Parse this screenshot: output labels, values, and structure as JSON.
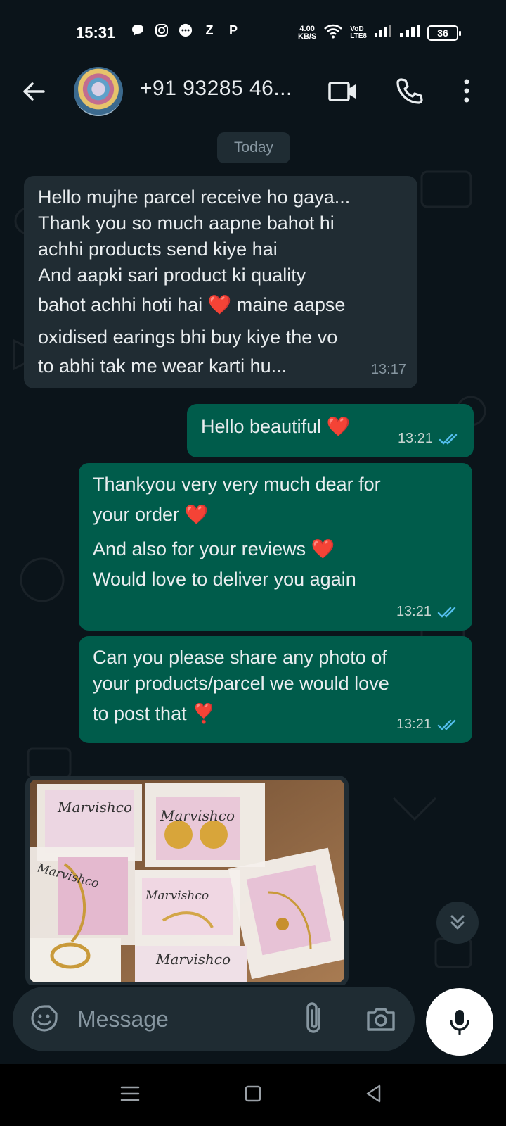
{
  "status_bar": {
    "time": "15:31",
    "left_icons": [
      "chat-bubble-icon",
      "instagram-icon",
      "message-dots-icon",
      "z-icon",
      "p-icon"
    ],
    "z_label": "Z",
    "p_label": "P",
    "speed_value": "4.00",
    "speed_unit": "KB/S",
    "volte_top": "VoD",
    "volte_bottom": "LTE8",
    "battery": "36"
  },
  "header": {
    "contact_name": "+91 93285 46..."
  },
  "chat": {
    "date_chip": "Today",
    "messages": [
      {
        "direction": "in",
        "lines": [
          "Hello mujhe parcel receive ho gaya...",
          "Thank you so much aapne bahot hi",
          "achhi products send kiye hai",
          "And aapki sari product ki quality",
          "bahot achhi hoti hai ❤️ maine aapse",
          "oxidised earings bhi buy kiye the vo",
          "to abhi tak me wear karti hu..."
        ],
        "time": "13:17"
      },
      {
        "direction": "out",
        "lines": [
          "Hello beautiful ❤️"
        ],
        "time": "13:21"
      },
      {
        "direction": "out",
        "lines": [
          "Thankyou very very much dear for",
          "your order ❤️",
          "And also for your reviews ❤️",
          "Would love to deliver you again"
        ],
        "time": "13:21"
      },
      {
        "direction": "out",
        "lines": [
          "Can you please share any photo of",
          "your products/parcel we would love",
          "to post that ❣️"
        ],
        "time": "13:21"
      }
    ],
    "photo_brand_text": "Marvishco"
  },
  "input": {
    "placeholder": "Message"
  },
  "colors": {
    "background": "#0b141a",
    "incoming_bubble": "#202c33",
    "outgoing_bubble": "#005c4b",
    "read_tick": "#53bdeb"
  }
}
